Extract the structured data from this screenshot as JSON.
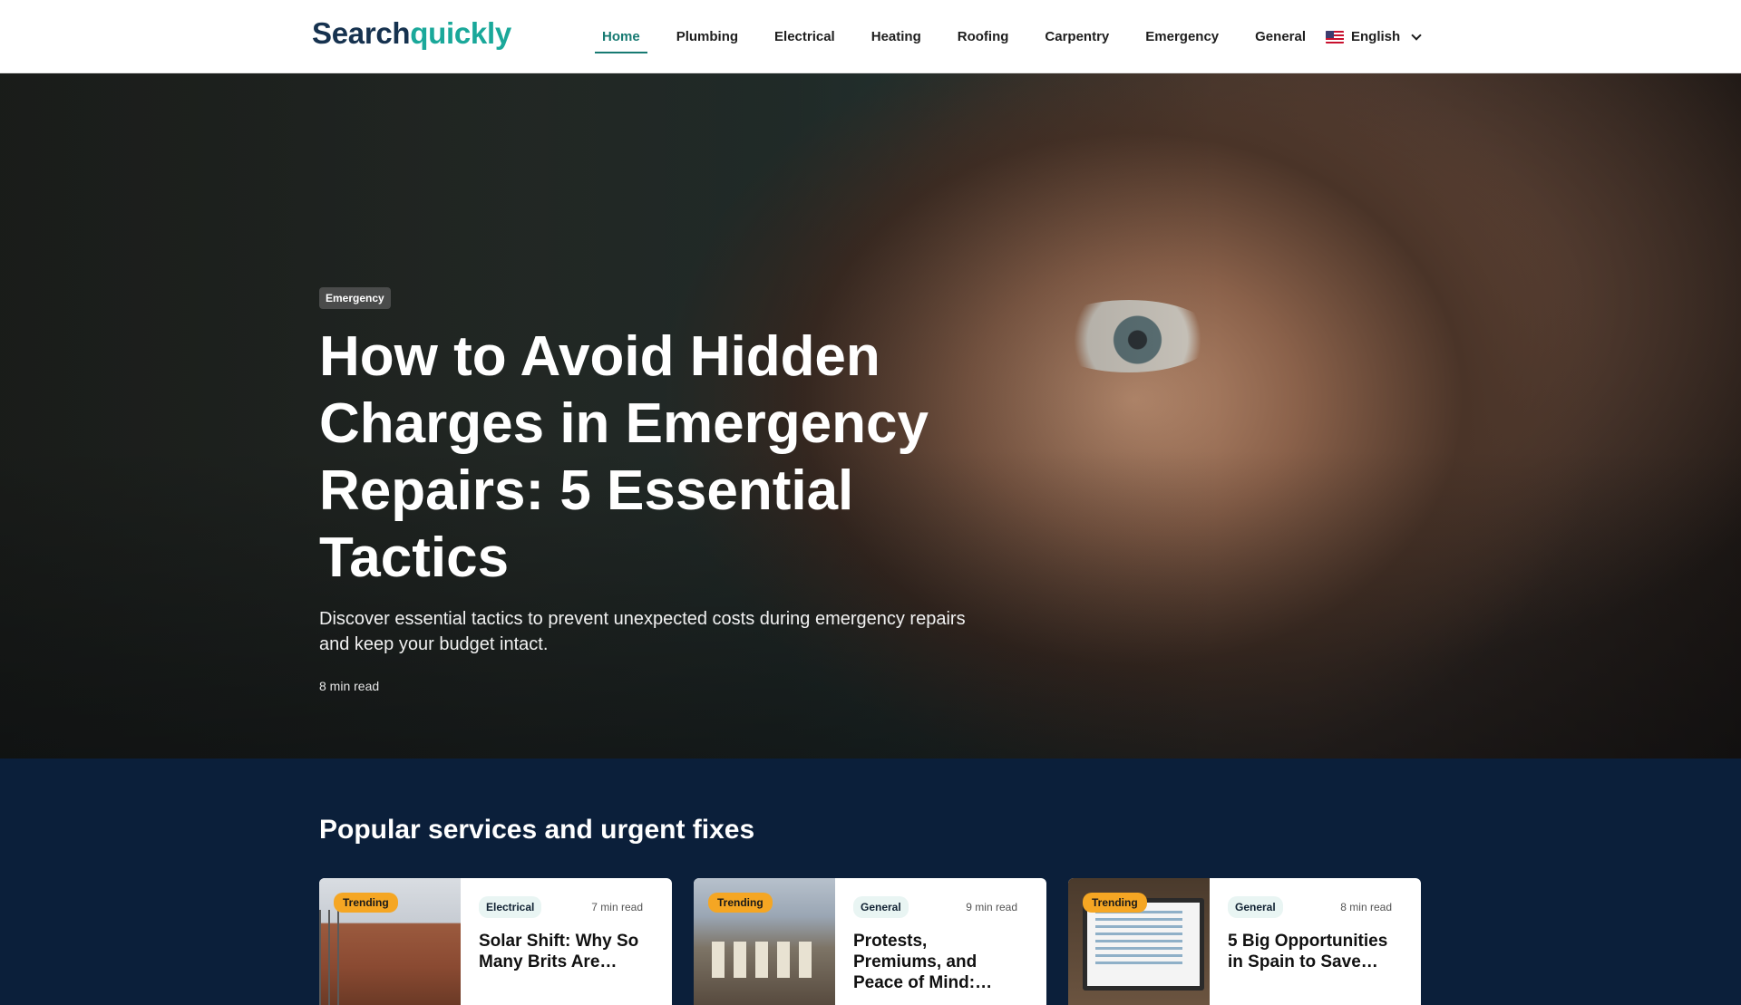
{
  "header": {
    "logo_part1": "Search",
    "logo_part2": "quickly",
    "nav": [
      {
        "label": "Home"
      },
      {
        "label": "Plumbing"
      },
      {
        "label": "Electrical"
      },
      {
        "label": "Heating"
      },
      {
        "label": "Roofing"
      },
      {
        "label": "Carpentry"
      },
      {
        "label": "Emergency"
      },
      {
        "label": "General"
      }
    ],
    "active_nav": "Home",
    "language": "English",
    "flag_icon": "us-flag-icon"
  },
  "hero": {
    "category": "Emergency",
    "title": "How to Avoid Hidden Charges in Emergency Repairs: 5 Essential Tactics",
    "subtitle": "Discover essential tactics to prevent unexpected costs during emergency repairs and keep your budget intact.",
    "read_time": "8 min read"
  },
  "popular": {
    "title": "Popular services and urgent fixes",
    "cards": [
      {
        "badge": "Trending",
        "category": "Electrical",
        "read_time": "7 min read",
        "title": "Solar Shift: Why So Many Brits Are…"
      },
      {
        "badge": "Trending",
        "category": "General",
        "read_time": "9 min read",
        "title": "Protests, Premiums, and Peace of Mind:…"
      },
      {
        "badge": "Trending",
        "category": "General",
        "read_time": "8 min read",
        "title": "5 Big Opportunities in Spain to Save…"
      }
    ]
  },
  "colors": {
    "brand_dark": "#16324f",
    "brand_teal": "#1aa89a",
    "nav_active": "#177a72",
    "section_bg": "#0b1f3a",
    "trending_badge": "#f5a623"
  }
}
